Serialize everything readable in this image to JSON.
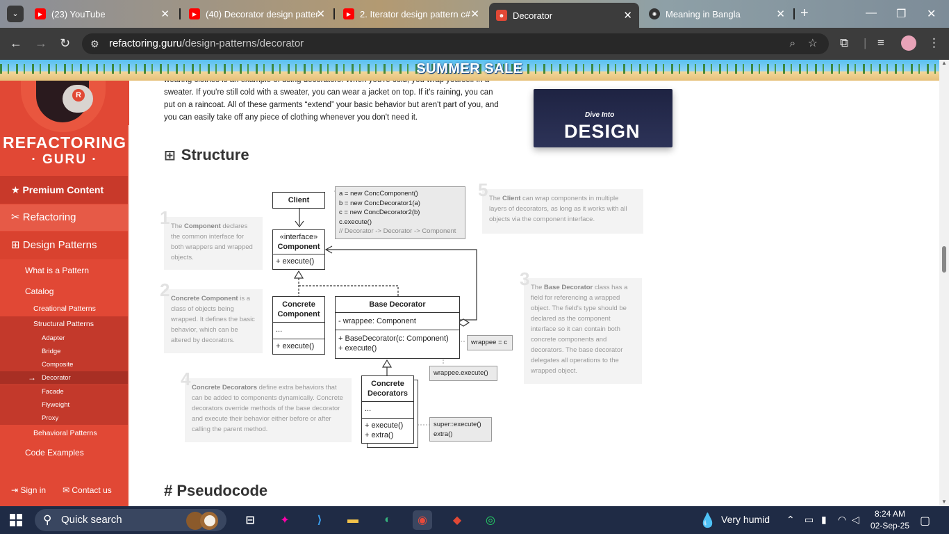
{
  "browser": {
    "tabs": [
      {
        "title": "(23) YouTube",
        "icon": "youtube-icon"
      },
      {
        "title": "(40) Decorator design patter",
        "icon": "youtube-icon"
      },
      {
        "title": "2. Iterator design pattern c#",
        "icon": "youtube-icon"
      },
      {
        "title": "Decorator",
        "icon": "refactoring-guru-icon"
      },
      {
        "title": "Meaning in Bangla",
        "icon": "chatgpt-icon"
      }
    ],
    "new_tab": "+",
    "url_domain": "refactoring.guru",
    "url_path": "/design-patterns/decorator"
  },
  "banner": {
    "text": "SUMMER SALE"
  },
  "sidebar": {
    "logo_line1": "REFACTORING",
    "logo_line2": "· GURU ·",
    "premium": "Premium Content",
    "refactoring": "Refactoring",
    "design_patterns": "Design Patterns",
    "what_is": "What is a Pattern",
    "catalog": "Catalog",
    "creational": "Creational Patterns",
    "structural": "Structural Patterns",
    "structural_items": [
      "Adapter",
      "Bridge",
      "Composite",
      "Decorator",
      "Facade",
      "Flyweight",
      "Proxy"
    ],
    "behavioral": "Behavioral Patterns",
    "code_examples": "Code Examples",
    "sign_in": "Sign in",
    "contact": "Contact us"
  },
  "content": {
    "para_line0": "wearing clothes is an example of using decorators. When you're cold, you wrap yourself in a",
    "para_line1": "sweater. If you're still cold with a sweater, you can wear a jacket on top. If it's raining, you can",
    "para_line2": "put on a raincoat. All of these garments “extend” your basic behavior but aren't part of you, and",
    "para_line3": "you can easily take off any piece of clothing whenever you don't need it.",
    "book_line1": "Dive Into",
    "book_line2": "DESIGN",
    "structure_title": "Structure",
    "pseudocode_title": "Pseudocode"
  },
  "diagram": {
    "client": "Client",
    "code_lines": [
      "a = new ConcComponent()",
      "b = new ConcDecorator1(a)",
      "c = new ConcDecorator2(b)",
      "c.execute()",
      "// Decorator -> Decorator -> Component"
    ],
    "component_stereo": "«interface»",
    "component_name": "Component",
    "component_method": "+ execute()",
    "concrete_component": "Concrete Component",
    "cc_field": "...",
    "cc_method": "+ execute()",
    "base_decorator": "Base Decorator",
    "bd_field": "- wrappee: Component",
    "bd_ctor": "+ BaseDecorator(c: Component)",
    "bd_method": "+ execute()",
    "wrappee_assign": "wrappee = c",
    "wrappee_exec": "wrappee.execute()",
    "concrete_decorators": "Concrete Decorators",
    "cd_field": "...",
    "cd_method1": "+ execute()",
    "cd_method2": "+ extra()",
    "super_exec": "super::execute()",
    "extra_call": "extra()",
    "notes": [
      {
        "num": "1",
        "bold": "Component",
        "pre": "The ",
        "post": " declares the common interface for both wrappers and wrapped objects."
      },
      {
        "num": "2",
        "bold": "Concrete Component",
        "pre": "",
        "post": " is a class of objects being wrapped. It defines the basic behavior, which can be altered by decorators."
      },
      {
        "num": "3",
        "bold": "Base Decorator",
        "pre": "The ",
        "post": " class has a field for referencing a wrapped object. The field's type should be declared as the component interface so it can contain both concrete components and decorators. The base decorator delegates all operations to the wrapped object."
      },
      {
        "num": "4",
        "bold": "Concrete Decorators",
        "pre": "",
        "post": " define extra behaviors that can be added to components dynamically. Concrete decorators override methods of the base decorator and execute their behavior either before or after calling the parent method."
      },
      {
        "num": "5",
        "bold": "Client",
        "pre": "The ",
        "post": " can wrap components in multiple layers of decorators, as long as it works with all objects via the component interface."
      }
    ]
  },
  "taskbar": {
    "search_label": "Quick search",
    "weather": "Very humid",
    "time": "8:24 AM",
    "date": "02-Sep-25"
  },
  "colors": {
    "sidebar": "#e14835",
    "premium": "#c8392a",
    "taskbar": "#1f2b45"
  }
}
